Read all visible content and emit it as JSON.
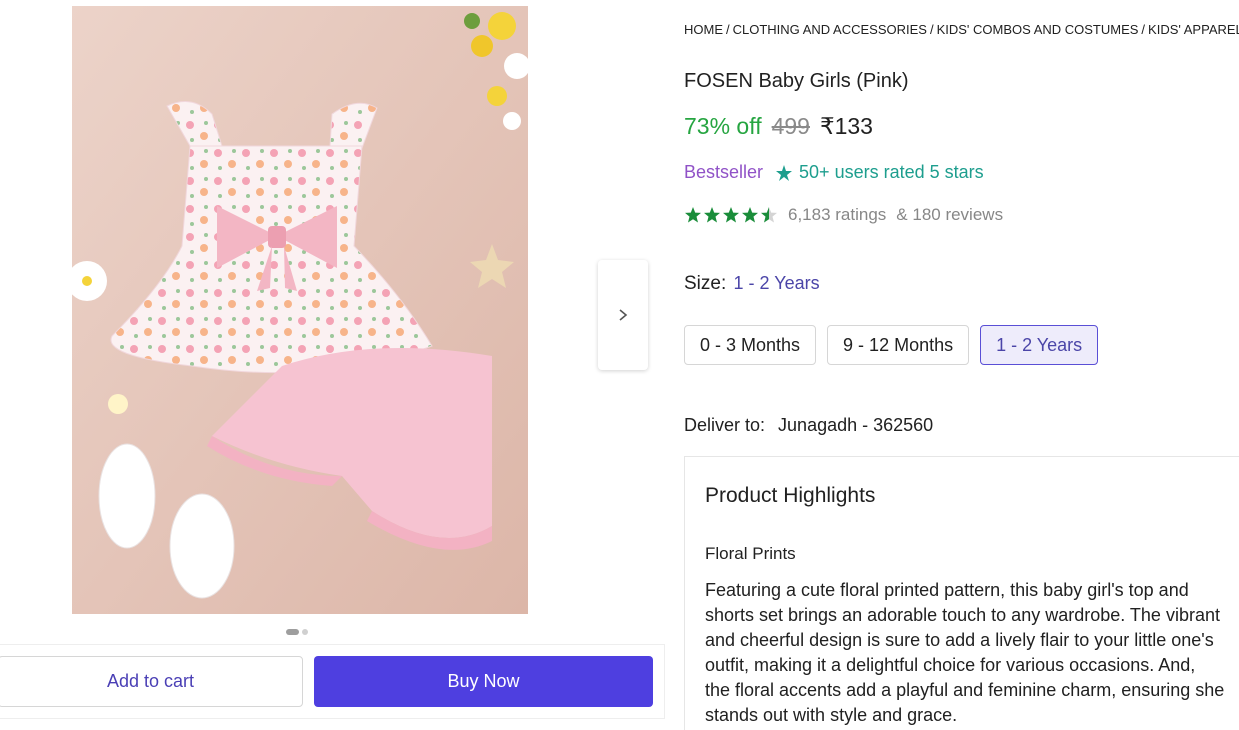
{
  "breadcrumb": [
    "HOME",
    "CLOTHING AND ACCESSORIES",
    "KIDS' COMBOS AND COSTUMES",
    "KIDS' APPAREL C"
  ],
  "product": {
    "title": "FOSEN Baby Girls (Pink)",
    "discount": "73% off",
    "mrp": "499",
    "price": "₹133"
  },
  "badges": {
    "bestseller": "Bestseller",
    "users_rated": "50+ users rated 5 stars"
  },
  "rating": {
    "stars_value": 4.5,
    "ratings_text": "6,183 ratings",
    "reviews_text": "& 180 reviews",
    "star_color": "#1a8d3a"
  },
  "size": {
    "label": "Size:",
    "selected": "1 - 2 Years",
    "options": [
      "0 - 3 Months",
      "9 - 12 Months",
      "1 - 2 Years"
    ]
  },
  "delivery": {
    "label": "Deliver to:",
    "location": "Junagadh - 362560"
  },
  "highlights": {
    "title": "Product Highlights",
    "subtitle": "Floral Prints",
    "body": "Featuring a cute floral printed pattern, this baby girl's top and shorts set brings an adorable touch to any wardrobe. The vibrant and cheerful design is sure to add a lively flair to your little one's outfit, making it a delightful choice for various occasions. And, the floral accents add a playful and feminine charm, ensuring she stands out with style and grace."
  },
  "actions": {
    "add_to_cart": "Add to cart",
    "buy_now": "Buy Now"
  },
  "gallery": {
    "image_icon": "product-photo",
    "carousel_current": 1,
    "carousel_total": 2,
    "next_icon": "chevron-right-icon"
  },
  "colors": {
    "accent": "#4e3fe0",
    "discount_green": "#26a541",
    "bestseller_purple": "#9052c7",
    "rated_teal": "#1d9e8e"
  }
}
